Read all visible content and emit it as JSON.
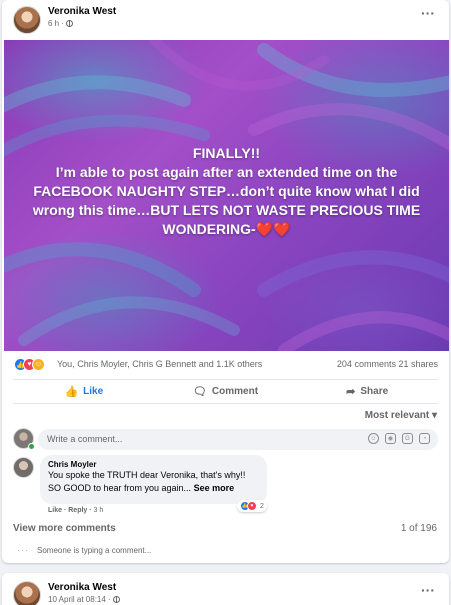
{
  "post": {
    "author": "Veronika West",
    "time": "6 h",
    "more": "···",
    "text_line1": "FINALLY!!",
    "text_body": "I’m able to post again after an extended time on the FACEBOOK NAUGHTY STEP…don’t quite know what I did wrong this time…BUT LETS NOT WASTE PRECIOUS TIME WONDERING-",
    "text_hearts": "❤️❤️",
    "reactions_summary": "You, Chris Moyler, Chris G Bennett and 1.1K others",
    "comments_count": "204 comments",
    "shares_count": "21 shares",
    "actions": {
      "like": "Like",
      "comment": "Comment",
      "share": "Share"
    },
    "sort_label": "Most relevant ▾",
    "write_placeholder": "Write a comment...",
    "comment": {
      "author": "Chris Moyler",
      "line1": "You spoke the TRUTH dear Veronika, that's why!!",
      "line2": "SO GOOD to hear from you again...",
      "see_more": "See more",
      "reaction_count": "2",
      "like": "Like",
      "reply": "Reply",
      "time": "3 h"
    },
    "view_more": "View more comments",
    "pager": "1 of 196",
    "typing": "Someone is typing a comment..."
  },
  "next_post": {
    "author": "Veronika West",
    "time": "10 April at 08:14",
    "more": "···"
  },
  "icons": {
    "like": "thumbs-up-icon",
    "comment": "speech-bubble-icon",
    "share": "share-arrow-icon",
    "globe": "globe-icon",
    "emoji": "emoji-icon",
    "camera": "camera-icon",
    "gif": "gif-icon",
    "sticker": "sticker-icon"
  },
  "colors": {
    "accent": "#1877f2",
    "background": "#f0f2f5",
    "image_purple": "#a34fc8",
    "heart": "#ff2f3a"
  }
}
